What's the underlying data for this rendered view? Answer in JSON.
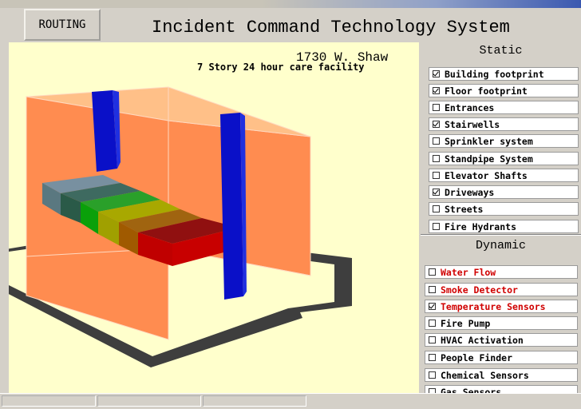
{
  "header": {
    "routing_label": "ROUTING",
    "title": "Incident Command Technology System"
  },
  "viewport": {
    "address": "1730 W. Shaw",
    "description": "7 Story 24 hour care facility"
  },
  "static": {
    "title": "Static",
    "items": [
      {
        "label": "Building footprint",
        "checked": true
      },
      {
        "label": "Floor footprint",
        "checked": true
      },
      {
        "label": "Entrances",
        "checked": false
      },
      {
        "label": "Stairwells",
        "checked": true
      },
      {
        "label": "Sprinkler system",
        "checked": false
      },
      {
        "label": "Standpipe System",
        "checked": false
      },
      {
        "label": "Elevator Shafts",
        "checked": false
      },
      {
        "label": "Driveways",
        "checked": true
      },
      {
        "label": "Streets",
        "checked": false
      },
      {
        "label": "Fire Hydrants",
        "checked": false
      }
    ]
  },
  "dynamic": {
    "title": "Dynamic",
    "items": [
      {
        "label": "Water Flow",
        "checked": false,
        "alert": true
      },
      {
        "label": "Smoke Detector",
        "checked": false,
        "alert": true
      },
      {
        "label": "Temperature Sensors",
        "checked": true,
        "alert": true
      },
      {
        "label": "Fire Pump",
        "checked": false,
        "alert": false
      },
      {
        "label": "HVAC Activation",
        "checked": false,
        "alert": false
      },
      {
        "label": "People Finder",
        "checked": false,
        "alert": false
      },
      {
        "label": "Chemical Sensors",
        "checked": false,
        "alert": false
      },
      {
        "label": "Gas Sensors",
        "checked": false,
        "alert": false
      }
    ]
  },
  "colors": {
    "viewport_bg": "#ffffcc",
    "building": "#ff8c50",
    "stairwell": "#0a10c8",
    "alert_text": "#d00000",
    "temperature_gradient": [
      "#5a7880",
      "#2a5a48",
      "#0aa00a",
      "#a0a000",
      "#a05a00",
      "#b80000"
    ]
  }
}
